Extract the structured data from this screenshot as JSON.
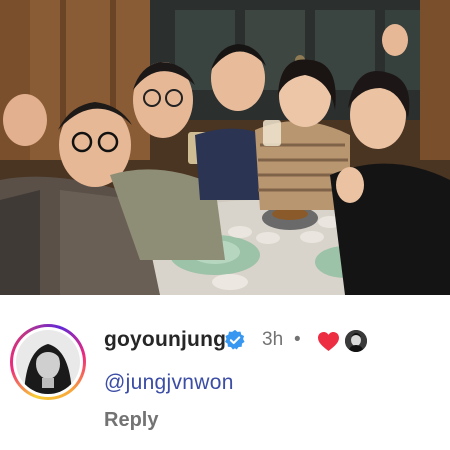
{
  "comment": {
    "username": "goyounjung",
    "time": "3h",
    "separator": "•",
    "text": "@jungjvnwon",
    "reply_label": "Reply"
  },
  "icons": {
    "verified": "verified-badge-icon",
    "heart": "heart-icon",
    "liker": "liker-avatar"
  },
  "colors": {
    "verified": "#3897f0",
    "heart": "#ed2d42",
    "mention": "#3b4da5",
    "secondary_text": "#737373"
  }
}
